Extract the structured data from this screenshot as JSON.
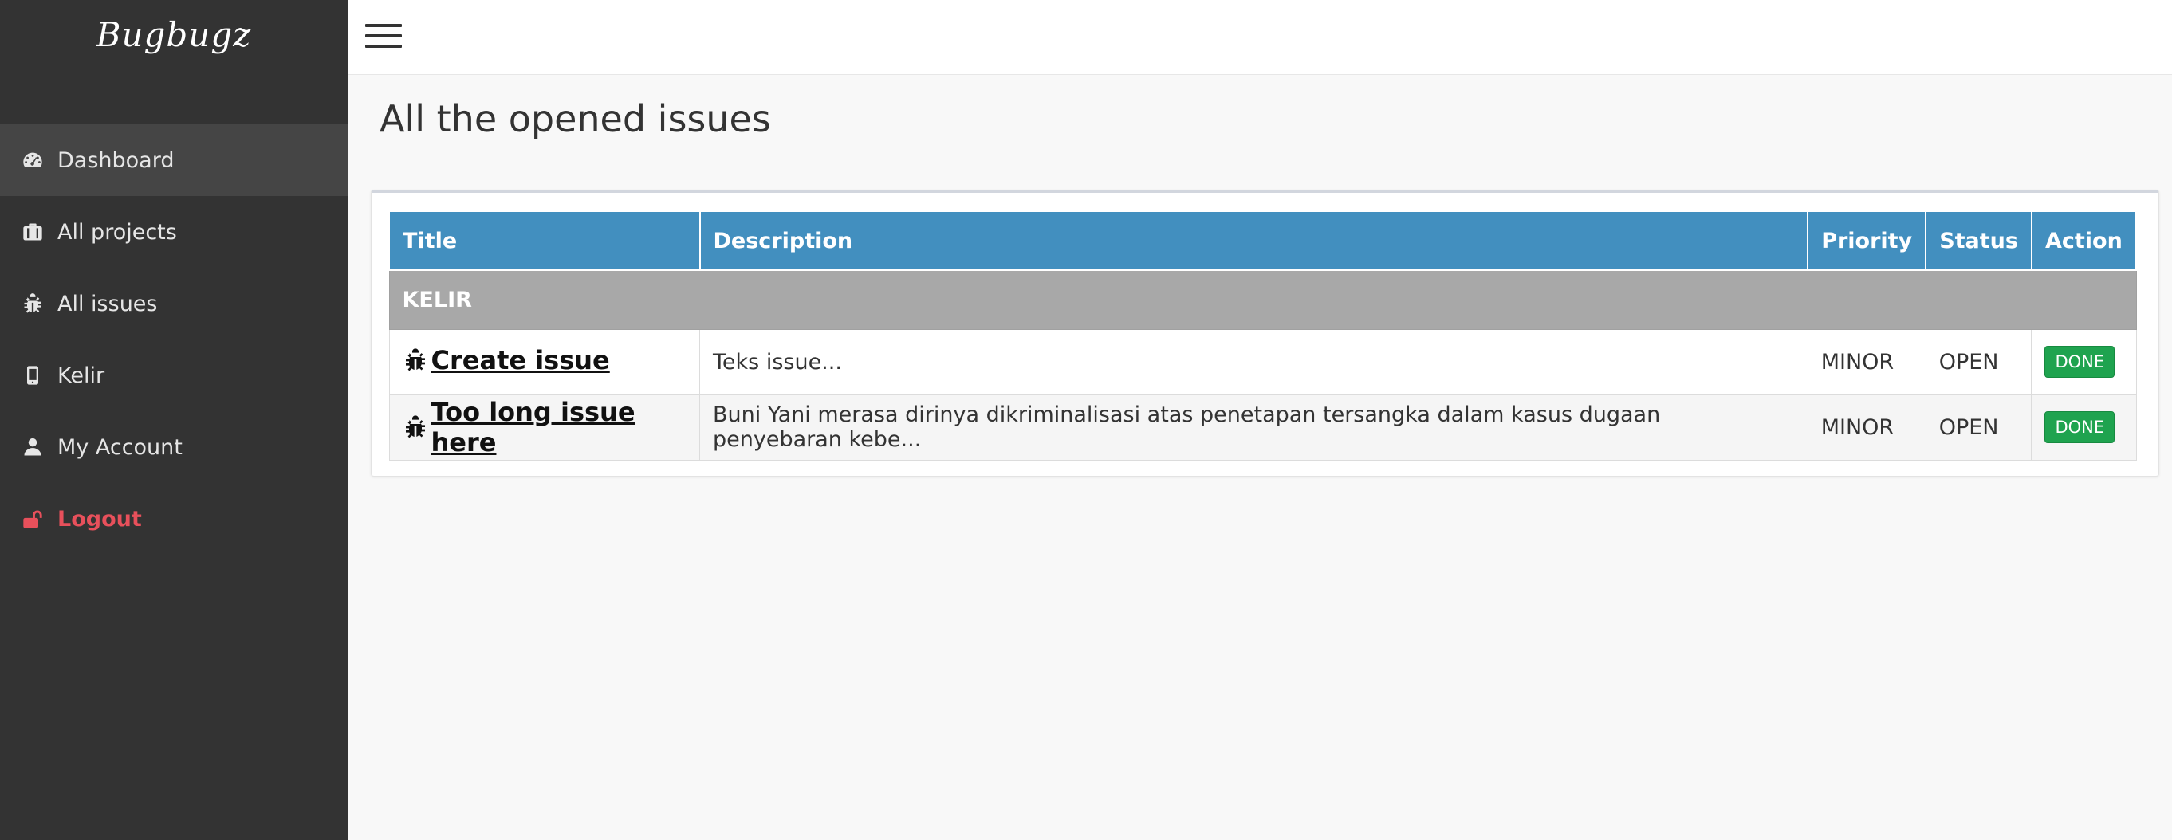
{
  "app": {
    "brand": "Bugbugz"
  },
  "sidebar": {
    "items": [
      {
        "label": "Dashboard",
        "icon": "dashboard-icon",
        "active": true
      },
      {
        "label": "All projects",
        "icon": "briefcase-icon"
      },
      {
        "label": "All issues",
        "icon": "bug-icon"
      },
      {
        "label": "Kelir",
        "icon": "mobile-icon"
      },
      {
        "label": "My Account",
        "icon": "user-icon"
      },
      {
        "label": "Logout",
        "icon": "unlock-icon",
        "color": "#e8505b"
      }
    ]
  },
  "main": {
    "title": "All the opened issues",
    "table": {
      "headers": [
        "Title",
        "Description",
        "Priority",
        "Status",
        "Action"
      ],
      "group": "KELIR",
      "rows": [
        {
          "title": "Create issue",
          "description": "Teks issue...",
          "priority": "MINOR",
          "status": "OPEN",
          "action": "DONE"
        },
        {
          "title": "Too long issue here",
          "description": "Buni Yani merasa dirinya dikriminalisasi atas penetapan tersangka dalam kasus dugaan penyebaran kebe...",
          "priority": "MINOR",
          "status": "OPEN",
          "action": "DONE"
        }
      ]
    }
  },
  "colors": {
    "sidebar_bg": "#333333",
    "table_header": "#428fbf",
    "group_row": "#a8a8a8",
    "done_button": "#1fa34f",
    "logout": "#e8505b"
  }
}
